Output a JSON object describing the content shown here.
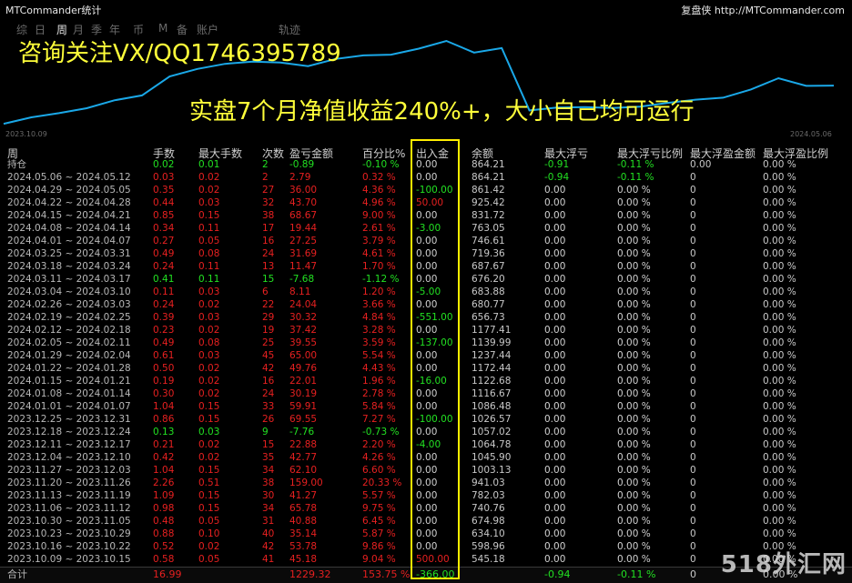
{
  "window": {
    "title": "MTCommander统计",
    "site": "复盘侠 http://MTCommander.com"
  },
  "tabs": [
    {
      "label": "综",
      "active": false
    },
    {
      "label": "日",
      "active": false
    },
    {
      "label": "周",
      "active": true
    },
    {
      "label": "月",
      "active": false
    },
    {
      "label": "季",
      "active": false
    },
    {
      "label": "年",
      "active": false
    },
    {
      "label": "币",
      "active": false
    },
    {
      "label": "M",
      "active": false
    },
    {
      "label": "备",
      "active": false
    },
    {
      "label": "账户",
      "active": false
    },
    {
      "label": "轨迹",
      "active": false
    }
  ],
  "promo": {
    "line1": "咨询关注VX/QQ1746395789",
    "line2": "实盘7个月净值收益240%+，大小自己均可运行"
  },
  "chart_data": {
    "type": "line",
    "x_start": "2023.10.09",
    "x_end": "2024.05.06",
    "series": [
      {
        "values": [
          545.18,
          598.96,
          634.1,
          674.98,
          740.76,
          782.03,
          941.03,
          1003.13,
          1045.9,
          1064.78,
          1057.02,
          1026.57,
          1086.48,
          1116.67,
          1122.68,
          1172.44,
          1237.44,
          1139.99,
          1177.41,
          656.73,
          680.77,
          683.88,
          676.2,
          687.67,
          719.36,
          746.61,
          763.05,
          831.72,
          925.42,
          861.42,
          864.21
        ]
      }
    ],
    "line_color": "#1aa8e8"
  },
  "watermark": "518外汇网",
  "headers": [
    "周",
    "手数",
    "最大手数",
    "次数",
    "盈亏金额",
    "百分比%",
    "出入金",
    "余额",
    "最大浮亏",
    "最大浮亏比例",
    "最大浮盈金额",
    "最大浮盈比例"
  ],
  "rows": [
    {
      "period": "持仓",
      "lots": "0.02",
      "maxlots": "0.01",
      "count": "2",
      "pnl": "-0.89",
      "pct": "-0.10 %",
      "flow": "0.00",
      "balance": "864.21",
      "maxdd": "-0.91",
      "maxddpct": "-0.11 %",
      "maxfp": "0.00",
      "maxfppct": "0.00 %"
    },
    {
      "period": "2024.05.06 ~ 2024.05.12",
      "lots": "0.03",
      "maxlots": "0.02",
      "count": "2",
      "pnl": "2.79",
      "pct": "0.32 %",
      "flow": "0.00",
      "balance": "864.21",
      "maxdd": "-0.94",
      "maxddpct": "-0.11 %",
      "maxfp": "0",
      "maxfppct": "0.00 %"
    },
    {
      "period": "2024.04.29 ~ 2024.05.05",
      "lots": "0.35",
      "maxlots": "0.02",
      "count": "27",
      "pnl": "36.00",
      "pct": "4.36 %",
      "flow": "-100.00",
      "balance": "861.42",
      "maxdd": "0.00",
      "maxddpct": "0.00 %",
      "maxfp": "0",
      "maxfppct": "0.00 %"
    },
    {
      "period": "2024.04.22 ~ 2024.04.28",
      "lots": "0.44",
      "maxlots": "0.03",
      "count": "32",
      "pnl": "43.70",
      "pct": "4.96 %",
      "flow": "50.00",
      "balance": "925.42",
      "maxdd": "0.00",
      "maxddpct": "0.00 %",
      "maxfp": "0",
      "maxfppct": "0.00 %"
    },
    {
      "period": "2024.04.15 ~ 2024.04.21",
      "lots": "0.85",
      "maxlots": "0.15",
      "count": "38",
      "pnl": "68.67",
      "pct": "9.00 %",
      "flow": "0.00",
      "balance": "831.72",
      "maxdd": "0.00",
      "maxddpct": "0.00 %",
      "maxfp": "0",
      "maxfppct": "0.00 %"
    },
    {
      "period": "2024.04.08 ~ 2024.04.14",
      "lots": "0.34",
      "maxlots": "0.11",
      "count": "17",
      "pnl": "19.44",
      "pct": "2.61 %",
      "flow": "-3.00",
      "balance": "763.05",
      "maxdd": "0.00",
      "maxddpct": "0.00 %",
      "maxfp": "0",
      "maxfppct": "0.00 %"
    },
    {
      "period": "2024.04.01 ~ 2024.04.07",
      "lots": "0.27",
      "maxlots": "0.05",
      "count": "16",
      "pnl": "27.25",
      "pct": "3.79 %",
      "flow": "0.00",
      "balance": "746.61",
      "maxdd": "0.00",
      "maxddpct": "0.00 %",
      "maxfp": "0",
      "maxfppct": "0.00 %"
    },
    {
      "period": "2024.03.25 ~ 2024.03.31",
      "lots": "0.49",
      "maxlots": "0.08",
      "count": "24",
      "pnl": "31.69",
      "pct": "4.61 %",
      "flow": "0.00",
      "balance": "719.36",
      "maxdd": "0.00",
      "maxddpct": "0.00 %",
      "maxfp": "0",
      "maxfppct": "0.00 %"
    },
    {
      "period": "2024.03.18 ~ 2024.03.24",
      "lots": "0.24",
      "maxlots": "0.11",
      "count": "13",
      "pnl": "11.47",
      "pct": "1.70 %",
      "flow": "0.00",
      "balance": "687.67",
      "maxdd": "0.00",
      "maxddpct": "0.00 %",
      "maxfp": "0",
      "maxfppct": "0.00 %"
    },
    {
      "period": "2024.03.11 ~ 2024.03.17",
      "lots": "0.41",
      "maxlots": "0.11",
      "count": "15",
      "pnl": "-7.68",
      "pct": "-1.12 %",
      "flow": "0.00",
      "balance": "676.20",
      "maxdd": "0.00",
      "maxddpct": "0.00 %",
      "maxfp": "0",
      "maxfppct": "0.00 %"
    },
    {
      "period": "2024.03.04 ~ 2024.03.10",
      "lots": "0.11",
      "maxlots": "0.03",
      "count": "6",
      "pnl": "8.11",
      "pct": "1.20 %",
      "flow": "-5.00",
      "balance": "683.88",
      "maxdd": "0.00",
      "maxddpct": "0.00 %",
      "maxfp": "0",
      "maxfppct": "0.00 %"
    },
    {
      "period": "2024.02.26 ~ 2024.03.03",
      "lots": "0.24",
      "maxlots": "0.02",
      "count": "22",
      "pnl": "24.04",
      "pct": "3.66 %",
      "flow": "0.00",
      "balance": "680.77",
      "maxdd": "0.00",
      "maxddpct": "0.00 %",
      "maxfp": "0",
      "maxfppct": "0.00 %"
    },
    {
      "period": "2024.02.19 ~ 2024.02.25",
      "lots": "0.39",
      "maxlots": "0.03",
      "count": "29",
      "pnl": "30.32",
      "pct": "4.84 %",
      "flow": "-551.00",
      "balance": "656.73",
      "maxdd": "0.00",
      "maxddpct": "0.00 %",
      "maxfp": "0",
      "maxfppct": "0.00 %"
    },
    {
      "period": "2024.02.12 ~ 2024.02.18",
      "lots": "0.23",
      "maxlots": "0.02",
      "count": "19",
      "pnl": "37.42",
      "pct": "3.28 %",
      "flow": "0.00",
      "balance": "1177.41",
      "maxdd": "0.00",
      "maxddpct": "0.00 %",
      "maxfp": "0",
      "maxfppct": "0.00 %"
    },
    {
      "period": "2024.02.05 ~ 2024.02.11",
      "lots": "0.49",
      "maxlots": "0.08",
      "count": "25",
      "pnl": "39.55",
      "pct": "3.59 %",
      "flow": "-137.00",
      "balance": "1139.99",
      "maxdd": "0.00",
      "maxddpct": "0.00 %",
      "maxfp": "0",
      "maxfppct": "0.00 %"
    },
    {
      "period": "2024.01.29 ~ 2024.02.04",
      "lots": "0.61",
      "maxlots": "0.03",
      "count": "45",
      "pnl": "65.00",
      "pct": "5.54 %",
      "flow": "0.00",
      "balance": "1237.44",
      "maxdd": "0.00",
      "maxddpct": "0.00 %",
      "maxfp": "0",
      "maxfppct": "0.00 %"
    },
    {
      "period": "2024.01.22 ~ 2024.01.28",
      "lots": "0.50",
      "maxlots": "0.02",
      "count": "42",
      "pnl": "49.76",
      "pct": "4.43 %",
      "flow": "0.00",
      "balance": "1172.44",
      "maxdd": "0.00",
      "maxddpct": "0.00 %",
      "maxfp": "0",
      "maxfppct": "0.00 %"
    },
    {
      "period": "2024.01.15 ~ 2024.01.21",
      "lots": "0.19",
      "maxlots": "0.02",
      "count": "16",
      "pnl": "22.01",
      "pct": "1.96 %",
      "flow": "-16.00",
      "balance": "1122.68",
      "maxdd": "0.00",
      "maxddpct": "0.00 %",
      "maxfp": "0",
      "maxfppct": "0.00 %"
    },
    {
      "period": "2024.01.08 ~ 2024.01.14",
      "lots": "0.30",
      "maxlots": "0.02",
      "count": "24",
      "pnl": "30.19",
      "pct": "2.78 %",
      "flow": "0.00",
      "balance": "1116.67",
      "maxdd": "0.00",
      "maxddpct": "0.00 %",
      "maxfp": "0",
      "maxfppct": "0.00 %"
    },
    {
      "period": "2024.01.01 ~ 2024.01.07",
      "lots": "1.04",
      "maxlots": "0.15",
      "count": "33",
      "pnl": "59.91",
      "pct": "5.84 %",
      "flow": "0.00",
      "balance": "1086.48",
      "maxdd": "0.00",
      "maxddpct": "0.00 %",
      "maxfp": "0",
      "maxfppct": "0.00 %"
    },
    {
      "period": "2023.12.25 ~ 2023.12.31",
      "lots": "0.86",
      "maxlots": "0.15",
      "count": "26",
      "pnl": "69.55",
      "pct": "7.27 %",
      "flow": "-100.00",
      "balance": "1026.57",
      "maxdd": "0.00",
      "maxddpct": "0.00 %",
      "maxfp": "0",
      "maxfppct": "0.00 %"
    },
    {
      "period": "2023.12.18 ~ 2023.12.24",
      "lots": "0.13",
      "maxlots": "0.03",
      "count": "9",
      "pnl": "-7.76",
      "pct": "-0.73 %",
      "flow": "0.00",
      "balance": "1057.02",
      "maxdd": "0.00",
      "maxddpct": "0.00 %",
      "maxfp": "0",
      "maxfppct": "0.00 %"
    },
    {
      "period": "2023.12.11 ~ 2023.12.17",
      "lots": "0.21",
      "maxlots": "0.02",
      "count": "15",
      "pnl": "22.88",
      "pct": "2.20 %",
      "flow": "-4.00",
      "balance": "1064.78",
      "maxdd": "0.00",
      "maxddpct": "0.00 %",
      "maxfp": "0",
      "maxfppct": "0.00 %"
    },
    {
      "period": "2023.12.04 ~ 2023.12.10",
      "lots": "0.42",
      "maxlots": "0.02",
      "count": "35",
      "pnl": "42.77",
      "pct": "4.26 %",
      "flow": "0.00",
      "balance": "1045.90",
      "maxdd": "0.00",
      "maxddpct": "0.00 %",
      "maxfp": "0",
      "maxfppct": "0.00 %"
    },
    {
      "period": "2023.11.27 ~ 2023.12.03",
      "lots": "1.04",
      "maxlots": "0.15",
      "count": "34",
      "pnl": "62.10",
      "pct": "6.60 %",
      "flow": "0.00",
      "balance": "1003.13",
      "maxdd": "0.00",
      "maxddpct": "0.00 %",
      "maxfp": "0",
      "maxfppct": "0.00 %"
    },
    {
      "period": "2023.11.20 ~ 2023.11.26",
      "lots": "2.26",
      "maxlots": "0.51",
      "count": "38",
      "pnl": "159.00",
      "pct": "20.33 %",
      "flow": "0.00",
      "balance": "941.03",
      "maxdd": "0.00",
      "maxddpct": "0.00 %",
      "maxfp": "0",
      "maxfppct": "0.00 %"
    },
    {
      "period": "2023.11.13 ~ 2023.11.19",
      "lots": "1.09",
      "maxlots": "0.15",
      "count": "30",
      "pnl": "41.27",
      "pct": "5.57 %",
      "flow": "0.00",
      "balance": "782.03",
      "maxdd": "0.00",
      "maxddpct": "0.00 %",
      "maxfp": "0",
      "maxfppct": "0.00 %"
    },
    {
      "period": "2023.11.06 ~ 2023.11.12",
      "lots": "0.98",
      "maxlots": "0.15",
      "count": "34",
      "pnl": "65.78",
      "pct": "9.75 %",
      "flow": "0.00",
      "balance": "740.76",
      "maxdd": "0.00",
      "maxddpct": "0.00 %",
      "maxfp": "0",
      "maxfppct": "0.00 %"
    },
    {
      "period": "2023.10.30 ~ 2023.11.05",
      "lots": "0.48",
      "maxlots": "0.05",
      "count": "31",
      "pnl": "40.88",
      "pct": "6.45 %",
      "flow": "0.00",
      "balance": "674.98",
      "maxdd": "0.00",
      "maxddpct": "0.00 %",
      "maxfp": "0",
      "maxfppct": "0.00 %"
    },
    {
      "period": "2023.10.23 ~ 2023.10.29",
      "lots": "0.88",
      "maxlots": "0.10",
      "count": "40",
      "pnl": "35.14",
      "pct": "5.87 %",
      "flow": "0.00",
      "balance": "634.10",
      "maxdd": "0.00",
      "maxddpct": "0.00 %",
      "maxfp": "0",
      "maxfppct": "0.00 %"
    },
    {
      "period": "2023.10.16 ~ 2023.10.22",
      "lots": "0.52",
      "maxlots": "0.02",
      "count": "42",
      "pnl": "53.78",
      "pct": "9.86 %",
      "flow": "0.00",
      "balance": "598.96",
      "maxdd": "0.00",
      "maxddpct": "0.00 %",
      "maxfp": "0",
      "maxfppct": "0.00 %"
    },
    {
      "period": "2023.10.09 ~ 2023.10.15",
      "lots": "0.58",
      "maxlots": "0.05",
      "count": "41",
      "pnl": "45.18",
      "pct": "9.04 %",
      "flow": "500.00",
      "balance": "545.18",
      "maxdd": "0.00",
      "maxddpct": "0.00 %",
      "maxfp": "0",
      "maxfppct": "0.00 %"
    }
  ],
  "total": {
    "period": "合计",
    "lots": "16.99",
    "maxlots": "",
    "count": "",
    "pnl": "1229.32",
    "pct": "153.75 %",
    "flow": "-366.00",
    "balance": "",
    "maxdd": "-0.94",
    "maxddpct": "-0.11 %",
    "maxfp": "0",
    "maxfppct": "0.00 %"
  },
  "colors": {
    "positive": "#e62020",
    "negative": "#22e022",
    "highlight_box": "#ffee00",
    "promo_text": "#ffff3a"
  }
}
